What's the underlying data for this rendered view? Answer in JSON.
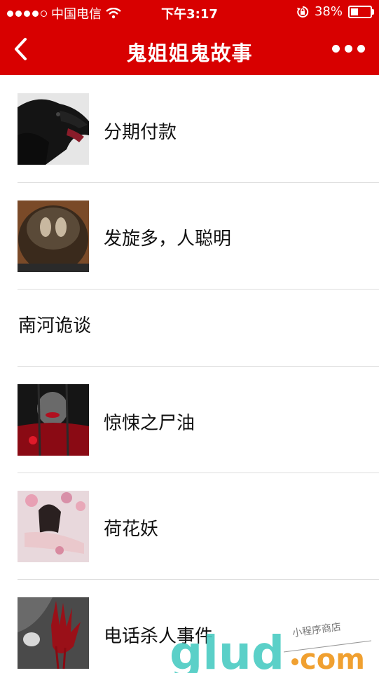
{
  "status_bar": {
    "carrier": "中国电信",
    "time": "下午3:17",
    "battery": "38%",
    "battery_level": 0.38
  },
  "nav": {
    "title": "鬼姐姐鬼故事",
    "back_icon": "back-chevron-icon",
    "more_icon": "more-dots-icon"
  },
  "items": [
    {
      "label": "分期付款",
      "thumb": "crow-thumbnail"
    },
    {
      "label": "发旋多，人聪明",
      "thumb": "hair-whorl-thumbnail"
    },
    {
      "label": "南河诡谈",
      "thumb": ""
    },
    {
      "label": "惊悚之尸油",
      "thumb": "horror-face-thumbnail"
    },
    {
      "label": "荷花妖",
      "thumb": "lotus-girl-thumbnail"
    },
    {
      "label": "电话杀人事件",
      "thumb": "bloody-hand-thumbnail"
    }
  ],
  "watermark": {
    "logo_text": "gludcom",
    "tagline": "小程序商店"
  },
  "colors": {
    "brand_red": "#d80000",
    "separator": "#dedede",
    "watermark_teal": "#4ecdc4",
    "watermark_orange": "#f0a030"
  }
}
